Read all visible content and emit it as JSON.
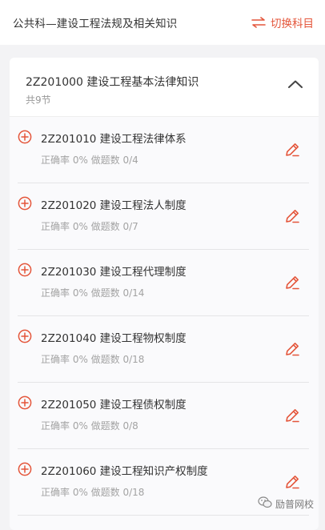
{
  "header": {
    "title": "公共科—建设工程法规及相关知识",
    "switch_label": "切换科目",
    "accent_color": "#e4553a",
    "switch_icon": "swap-arrows-icon"
  },
  "chapter": {
    "title": "2Z201000 建设工程基本法律知识",
    "subtitle": "共9节",
    "collapse_icon": "chevron-up-icon"
  },
  "sections": [
    {
      "title": "2Z201010 建设工程法律体系",
      "stats": "正确率 0% 做题数 0/4"
    },
    {
      "title": "2Z201020 建设工程法人制度",
      "stats": "正确率 0% 做题数 0/7"
    },
    {
      "title": "2Z201030 建设工程代理制度",
      "stats": "正确率 0% 做题数 0/14"
    },
    {
      "title": "2Z201040 建设工程物权制度",
      "stats": "正确率 0% 做题数 0/18"
    },
    {
      "title": "2Z201050 建设工程债权制度",
      "stats": "正确率 0% 做题数 0/8"
    },
    {
      "title": "2Z201060 建设工程知识产权制度",
      "stats": "正确率 0% 做题数 0/18"
    }
  ],
  "watermark": {
    "label": "励普网校",
    "icon": "wechat-icon"
  }
}
